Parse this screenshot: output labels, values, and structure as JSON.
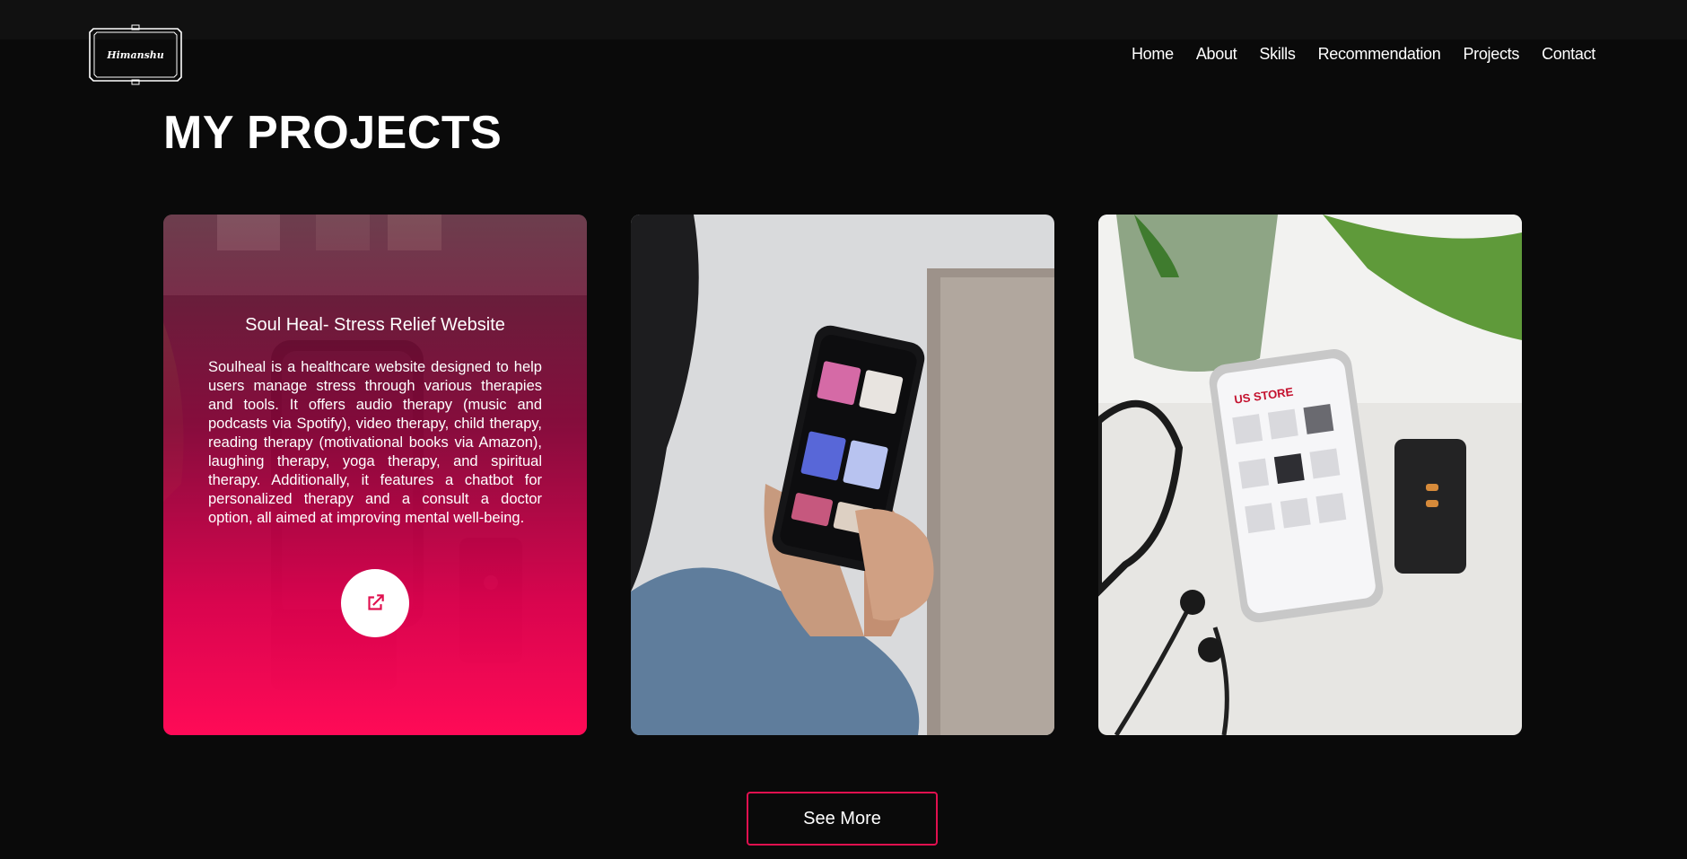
{
  "brand": {
    "logo_text": "Himanshu"
  },
  "nav": {
    "items": [
      {
        "label": "Home"
      },
      {
        "label": "About"
      },
      {
        "label": "Skills"
      },
      {
        "label": "Recommendation"
      },
      {
        "label": "Projects"
      },
      {
        "label": "Contact"
      }
    ]
  },
  "main": {
    "title": "MY PROJECTS",
    "projects": [
      {
        "title": "Soul Heal- Stress Relief Website",
        "description": "Soulheal is a healthcare website designed to help users manage stress through various therapies and tools. It offers audio therapy (music and podcasts via Spotify), video therapy, child therapy, reading therapy (motivational books via Amazon), laughing therapy, yoga therapy, and spiritual therapy. Additionally, it features a chatbot for personalized therapy and a consult a doctor option, all aimed at improving mental well-being.",
        "link_icon": "external-link-icon"
      },
      {
        "image": "music-app-phone-photo"
      },
      {
        "image": "us-store-phone-photo",
        "screen_brand": "US STORE"
      }
    ],
    "see_more_label": "See More"
  },
  "colors": {
    "background": "#0a0a0a",
    "accent": "#ff0a57",
    "button_border": "#e0104f"
  }
}
